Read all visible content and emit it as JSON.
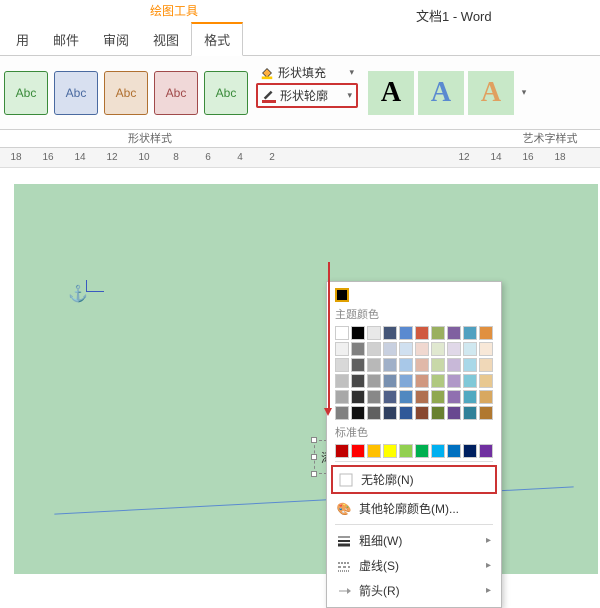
{
  "title_context": "绘图工具",
  "doc_title": "文档1 - Word",
  "tabs": [
    "用",
    "邮件",
    "审阅",
    "视图",
    "格式"
  ],
  "swatch_label": "Abc",
  "fill_label": "形状填充",
  "outline_label": "形状轮廓",
  "group_shape_styles": "形状样式",
  "group_wordart": "艺术字样式",
  "wa_letter": "A",
  "ruler_left": [
    "18",
    "16",
    "14",
    "12",
    "10",
    "8",
    "6",
    "4",
    "2"
  ],
  "ruler_right": [
    "12",
    "14",
    "16",
    "18"
  ],
  "textbox_text": "添加文字",
  "popup": {
    "theme_hdr": "主题颜色",
    "std_hdr": "标准色",
    "no_outline": "无轮廓(N)",
    "more_colors": "其他轮廓颜色(M)...",
    "weight": "粗细(W)",
    "dashes": "虚线(S)",
    "arrows": "箭头(R)"
  },
  "theme_colors": [
    [
      "#ffffff",
      "#000000",
      "#e8e8e8",
      "#445577",
      "#5a8ad0",
      "#d05a40",
      "#9ab060",
      "#8060a0",
      "#50a0c0",
      "#e09040"
    ],
    [
      "#f0f0f0",
      "#808080",
      "#d0d0d0",
      "#c8d0e0",
      "#d0e0f0",
      "#f0d8d0",
      "#e0e8d0",
      "#e0d8e8",
      "#d0e8f0",
      "#f8e8d8"
    ],
    [
      "#d8d8d8",
      "#606060",
      "#b8b8b8",
      "#a0b0c8",
      "#a8c8e8",
      "#e0b8a8",
      "#c8d8a8",
      "#c8b8d8",
      "#a8d8e8",
      "#f0d8b8"
    ],
    [
      "#c0c0c0",
      "#484848",
      "#a0a0a0",
      "#7890b0",
      "#80a8d8",
      "#d09880",
      "#b0c880",
      "#b098c8",
      "#80c8d8",
      "#e8c890"
    ],
    [
      "#a8a8a8",
      "#303030",
      "#888888",
      "#506088",
      "#5088c0",
      "#b07050",
      "#90a850",
      "#9070b0",
      "#50a8c0",
      "#d8a860"
    ],
    [
      "#808080",
      "#101010",
      "#606060",
      "#304060",
      "#305898",
      "#884830",
      "#688030",
      "#684890",
      "#308098",
      "#b07830"
    ]
  ],
  "std_colors": [
    "#c00000",
    "#ff0000",
    "#ffc000",
    "#ffff00",
    "#92d050",
    "#00b050",
    "#00b0f0",
    "#0070c0",
    "#002060",
    "#7030a0"
  ]
}
